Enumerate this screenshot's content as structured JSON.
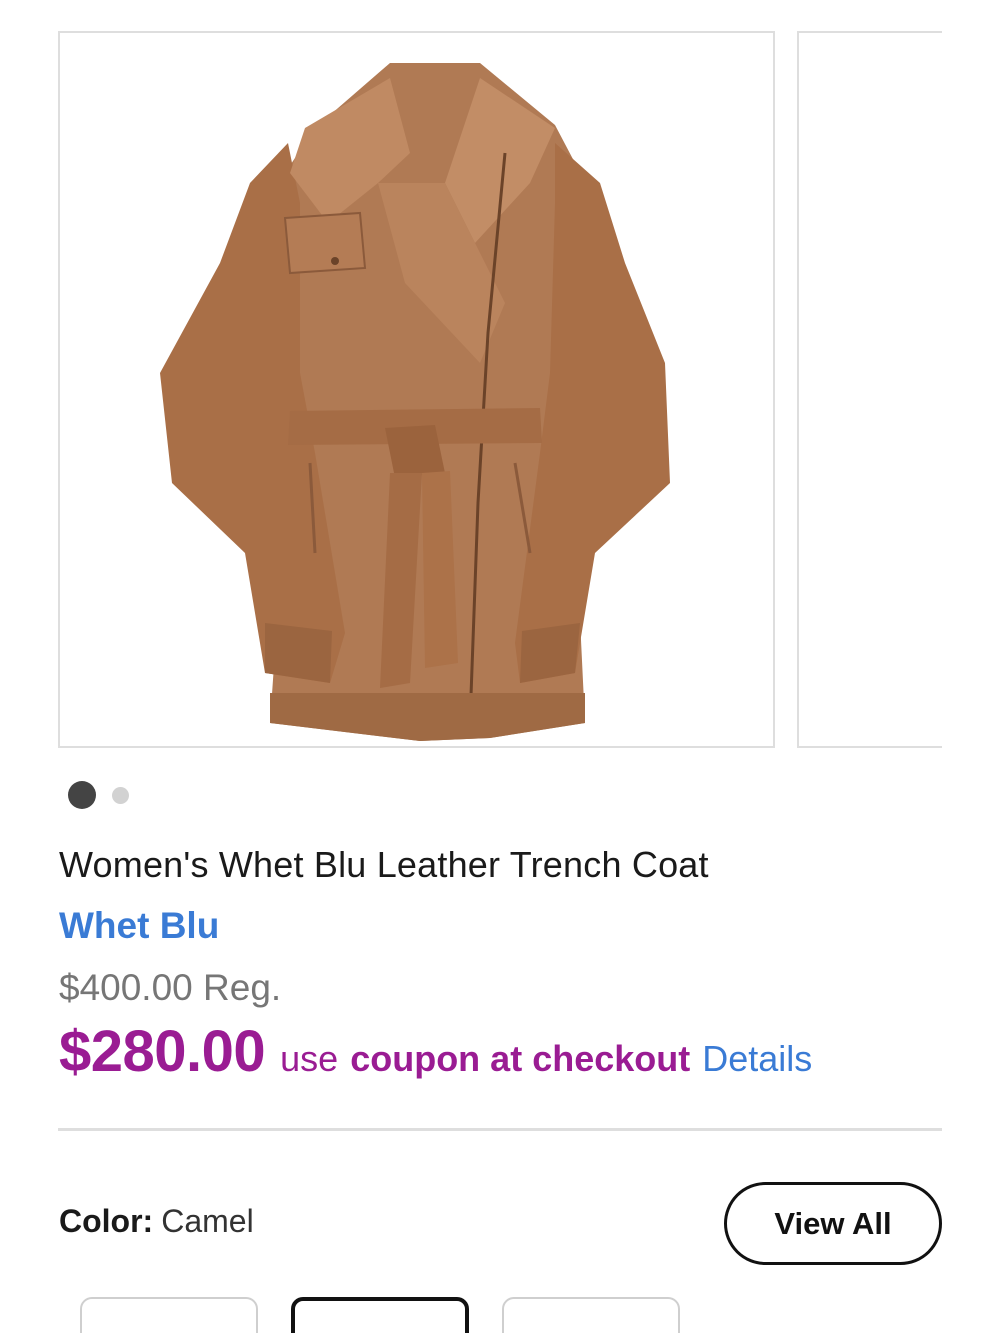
{
  "product": {
    "title": "Women's Whet Blu Leather Trench Coat",
    "brand": "Whet Blu",
    "regular_price": "$400.00 Reg.",
    "sale_price": "$280.00",
    "coupon_use": "use",
    "coupon_text": "coupon at checkout",
    "details_link": "Details"
  },
  "carousel": {
    "image_count": 2,
    "active_index": 0,
    "main_image": "leather-trench-coat-camel-photo",
    "next_image": "leather-trench-coat-partial-photo"
  },
  "color_selector": {
    "label": "Color:",
    "value": "Camel",
    "view_all_label": "View All",
    "swatch_count": 3,
    "selected_swatch": 1
  },
  "colors": {
    "coat": "#b07a54",
    "sale": "#9a1c93",
    "link": "#3a7bd5",
    "muted": "#767676"
  }
}
